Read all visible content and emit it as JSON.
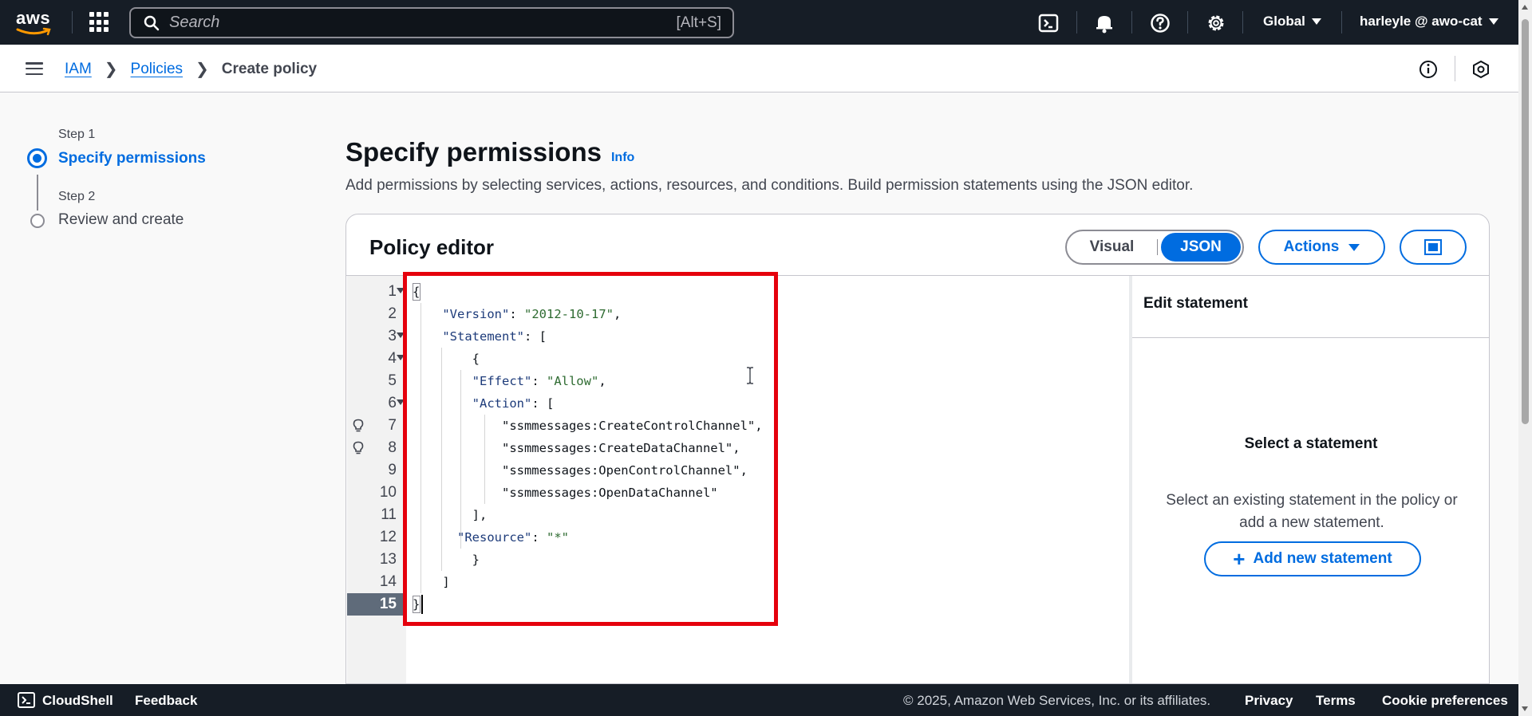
{
  "topbar": {
    "logo": "aws",
    "search_placeholder": "Search",
    "search_shortcut": "[Alt+S]",
    "region": "Global",
    "account": "harleyle @ awo-cat",
    "icons": [
      "cloudshell-icon",
      "bell-icon",
      "help-icon",
      "gear-icon"
    ]
  },
  "breadcrumb": {
    "items": [
      "IAM",
      "Policies"
    ],
    "current": "Create policy"
  },
  "steps": [
    {
      "label": "Step 1",
      "title": "Specify permissions",
      "state": "active"
    },
    {
      "label": "Step 2",
      "title": "Review and create",
      "state": "pending"
    }
  ],
  "main": {
    "title": "Specify permissions",
    "info": "Info",
    "description": "Add permissions by selecting services, actions, resources, and conditions. Build permission statements using the JSON editor."
  },
  "editor": {
    "title": "Policy editor",
    "modes": [
      "Visual",
      "JSON"
    ],
    "active_mode": "JSON",
    "actions_label": "Actions",
    "lines": [
      "{",
      "    \"Version\": \"2012-10-17\",",
      "    \"Statement\": [",
      "        {",
      "        \"Effect\": \"Allow\",",
      "        \"Action\": [",
      "            \"ssmmessages:CreateControlChannel\",",
      "            \"ssmmessages:CreateDataChannel\",",
      "            \"ssmmessages:OpenControlChannel\",",
      "            \"ssmmessages:OpenDataChannel\"",
      "        ],",
      "      \"Resource\": \"*\"",
      "        }",
      "    ]",
      "}"
    ],
    "active_line": 15
  },
  "edit_statement": {
    "title": "Edit statement",
    "empty_title": "Select a statement",
    "empty_desc": "Select an existing statement in the policy or add a new statement.",
    "add_label": "Add new statement"
  },
  "footer": {
    "cloudshell": "CloudShell",
    "feedback": "Feedback",
    "copyright": "© 2025, Amazon Web Services, Inc. or its affiliates.",
    "privacy": "Privacy",
    "terms": "Terms",
    "cookies": "Cookie preferences"
  },
  "colors": {
    "nav_bg": "#161d26",
    "accent": "#006ce0",
    "highlight_box": "#e5000c"
  }
}
